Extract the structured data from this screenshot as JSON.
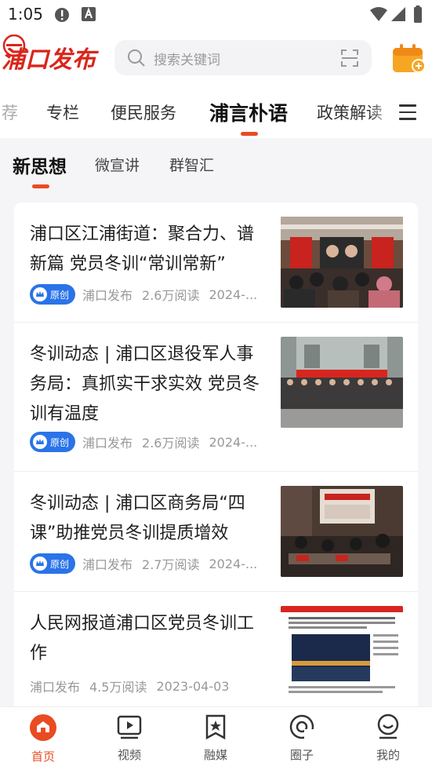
{
  "status_bar": {
    "time": "1:05"
  },
  "header": {
    "logo_text": "浦口发布",
    "search_placeholder": "搜索关键词"
  },
  "tabs": [
    {
      "label": "荐"
    },
    {
      "label": "专栏"
    },
    {
      "label": "便民服务"
    },
    {
      "label": "浦言朴语",
      "active": true
    },
    {
      "label": "政策解读"
    }
  ],
  "subtabs": [
    {
      "label": "新思想",
      "active": true
    },
    {
      "label": "微宣讲"
    },
    {
      "label": "群智汇"
    }
  ],
  "articles": [
    {
      "title": "浦口区江浦街道：聚合力、谱新篇 党员冬训“常训常新”",
      "badge": "原创",
      "source": "浦口发布",
      "reads": "2.6万阅读",
      "date": "2024-..."
    },
    {
      "title": "冬训动态 | 浦口区退役军人事务局：真抓实干求实效 党员冬训有温度",
      "badge": "原创",
      "source": "浦口发布",
      "reads": "2.6万阅读",
      "date": "2024-..."
    },
    {
      "title": "冬训动态 | 浦口区商务局“四课”助推党员冬训提质增效",
      "badge": "原创",
      "source": "浦口发布",
      "reads": "2.7万阅读",
      "date": "2024-..."
    },
    {
      "title": "人民网报道浦口区党员冬训工作",
      "source": "浦口发布",
      "reads": "4.5万阅读",
      "date": "2023-04-03"
    }
  ],
  "bottom_nav": [
    {
      "label": "首页",
      "icon": "home-icon",
      "active": true
    },
    {
      "label": "视频",
      "icon": "video-icon"
    },
    {
      "label": "融媒",
      "icon": "media-icon"
    },
    {
      "label": "圈子",
      "icon": "circle-icon"
    },
    {
      "label": "我的",
      "icon": "profile-icon"
    }
  ],
  "colors": {
    "accent": "#e94b22",
    "badge": "#2a73e8"
  }
}
